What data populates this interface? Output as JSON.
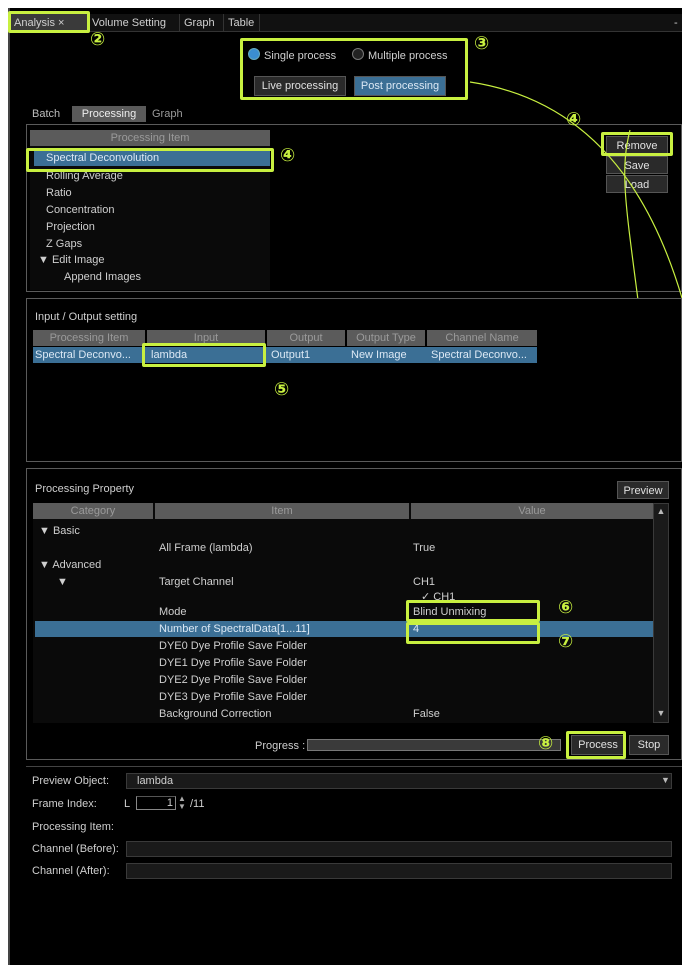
{
  "tabs": {
    "analysis": "Analysis ×",
    "volume": "Volume Setting",
    "graph": "Graph",
    "table": "Table"
  },
  "mode": {
    "single": "Single process",
    "multiple": "Multiple process",
    "live": "Live processing",
    "post": "Post processing"
  },
  "subtabs": {
    "batch": "Batch",
    "processing": "Processing",
    "graph": "Graph"
  },
  "processing_items": {
    "header": "Processing Item",
    "items": [
      "Spectral Deconvolution",
      "Rolling Average",
      "Ratio",
      "Concentration",
      "Projection",
      "Z Gaps",
      "▼ Edit Image",
      "Append Images"
    ]
  },
  "item_buttons": {
    "remove": "Remove",
    "save": "Save",
    "load": "Load"
  },
  "io": {
    "title": "Input / Output setting",
    "headers": [
      "Processing Item",
      "Input",
      "Output",
      "Output Type",
      "Channel Name"
    ],
    "row": [
      "Spectral Deconvo...",
      "lambda",
      "Output1",
      "New Image",
      "Spectral Deconvo..."
    ]
  },
  "property": {
    "title": "Processing Property",
    "preview": "Preview",
    "headers": [
      "Category",
      "Item",
      "Value"
    ],
    "rows": [
      {
        "cat": "▼ Basic",
        "item": "",
        "value": ""
      },
      {
        "cat": "",
        "item": "All Frame (lambda)",
        "value": "True"
      },
      {
        "cat": "▼ Advanced",
        "item": "",
        "value": ""
      },
      {
        "cat": "▼",
        "item": "Target Channel",
        "value": "CH1"
      },
      {
        "cat": "",
        "item": "",
        "value": "✓ CH1"
      },
      {
        "cat": "",
        "item": "Mode",
        "value": "Blind Unmixing"
      },
      {
        "cat": "",
        "item": "Number of SpectralData[1...11]",
        "value": "4"
      },
      {
        "cat": "",
        "item": "DYE0 Dye Profile Save Folder",
        "value": ""
      },
      {
        "cat": "",
        "item": "DYE1 Dye Profile Save Folder",
        "value": ""
      },
      {
        "cat": "",
        "item": "DYE2 Dye Profile Save Folder",
        "value": ""
      },
      {
        "cat": "",
        "item": "DYE3 Dye Profile Save Folder",
        "value": ""
      },
      {
        "cat": "",
        "item": "Background Correction",
        "value": "False"
      }
    ],
    "progress_label": "Progress :",
    "process": "Process",
    "stop": "Stop"
  },
  "preview": {
    "object_label": "Preview Object:",
    "object_value": "lambda",
    "frame_label": "Frame Index:",
    "frame_prefix": "L",
    "frame_value": "1",
    "frame_total": "/11",
    "item_label": "Processing Item:",
    "before_label": "Channel (Before):",
    "after_label": "Channel (After):"
  },
  "callouts": [
    "②",
    "③",
    "④",
    "④",
    "⑤",
    "⑥",
    "⑦",
    "⑧"
  ],
  "colors": {
    "highlight": "#c8f040",
    "selection": "#3b6f95",
    "background": "#000000"
  }
}
